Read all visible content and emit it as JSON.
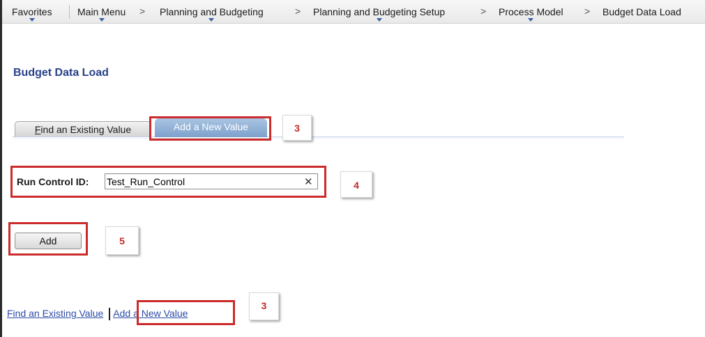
{
  "menubar": {
    "items": [
      "Favorites",
      "Main Menu",
      "Planning and Budgeting",
      "Planning and Budgeting Setup",
      "Process Model",
      "Budget Data Load"
    ],
    "separator": ">"
  },
  "page": {
    "title": "Budget Data Load"
  },
  "tabs": {
    "find_prefix": "F",
    "find_rest": "ind an Existing Value",
    "add": "Add a New Value"
  },
  "run_control": {
    "label": "Run Control ID:",
    "value": "Test_Run_Control",
    "clear_glyph": "✕"
  },
  "buttons": {
    "add": "Add"
  },
  "links": {
    "find": "Find an Existing Value",
    "add": "Add a New Value"
  },
  "callouts": {
    "tab": "3",
    "field": "4",
    "button": "5",
    "link": "3"
  },
  "colors": {
    "highlight": "#cc2b2b",
    "active_tab": "#8fb0d8",
    "title": "#28418a",
    "link": "#2b4ba7"
  }
}
